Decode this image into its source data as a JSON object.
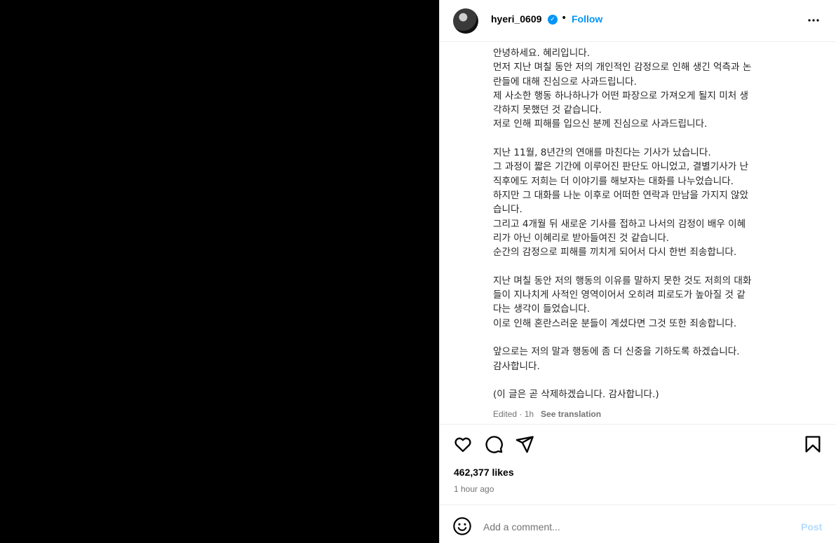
{
  "header": {
    "username": "hyeri_0609",
    "verified_badge": "✓",
    "separator": "•",
    "follow_label": "Follow",
    "more_icon": "more-horizontal-icon"
  },
  "caption": {
    "paragraphs": [
      [
        "안녕하세요. 혜리입니다.",
        "먼저 지난 며칠 동안 저의 개인적인 감정으로 인해 생긴 억측과 논",
        "란들에 대해 진심으로 사과드립니다.",
        "제 사소한 행동 하나하나가 어떤 파장으로 가져오게 될지 미처 생",
        "각하지 못했던 것 같습니다.",
        "저로 인해 피해를 입으신 분께 진심으로 사과드립니다."
      ],
      [
        "지난 11월, 8년간의 연애를 마친다는 기사가 났습니다.",
        "그 과정이 짧은 기간에 이루어진 판단도 아니었고, 결별기사가 난",
        "직후에도 저희는 더 이야기를 해보자는 대화를 나누었습니다.",
        "하지만 그 대화를 나눈 이후로 어떠한 연락과 만남을 가지지 않았",
        "습니다.",
        "그리고 4개월 뒤 새로운 기사를 접하고 나서의 감정이 배우 이혜",
        "리가 아닌 이혜리로 받아들여진 것 같습니다.",
        "순간의 감정으로 피해를 끼치게 되어서 다시 한번 죄송합니다."
      ],
      [
        "지난 며칠 동안 저의 행동의 이유를 말하지 못한 것도 저희의 대화",
        "들이 지나치게 사적인 영역이어서 오히려 피로도가 높아질 것 같",
        "다는 생각이 들었습니다.",
        "이로 인해 혼란스러운 분들이 계셨다면 그것 또한 죄송합니다."
      ],
      [
        "앞으로는 저의 말과 행동에 좀 더 신중을 기하도록 하겠습니다.",
        "감사합니다."
      ],
      [
        "(이 글은 곧 삭제하겠습니다. 감사합니다.)"
      ]
    ],
    "meta": "Edited · 1h",
    "see_translation": "See translation"
  },
  "actions": {
    "like_icon": "heart-icon",
    "comment_icon": "comment-icon",
    "share_icon": "send-icon",
    "save_icon": "bookmark-icon"
  },
  "likes": "462,377 likes",
  "timestamp": "1 hour ago",
  "comment": {
    "emoji_icon": "smiley-icon",
    "placeholder": "Add a comment...",
    "post_label": "Post"
  },
  "colors": {
    "accent": "#0095f6",
    "post_disabled": "#b3dbff",
    "secondary_text": "#737373"
  }
}
